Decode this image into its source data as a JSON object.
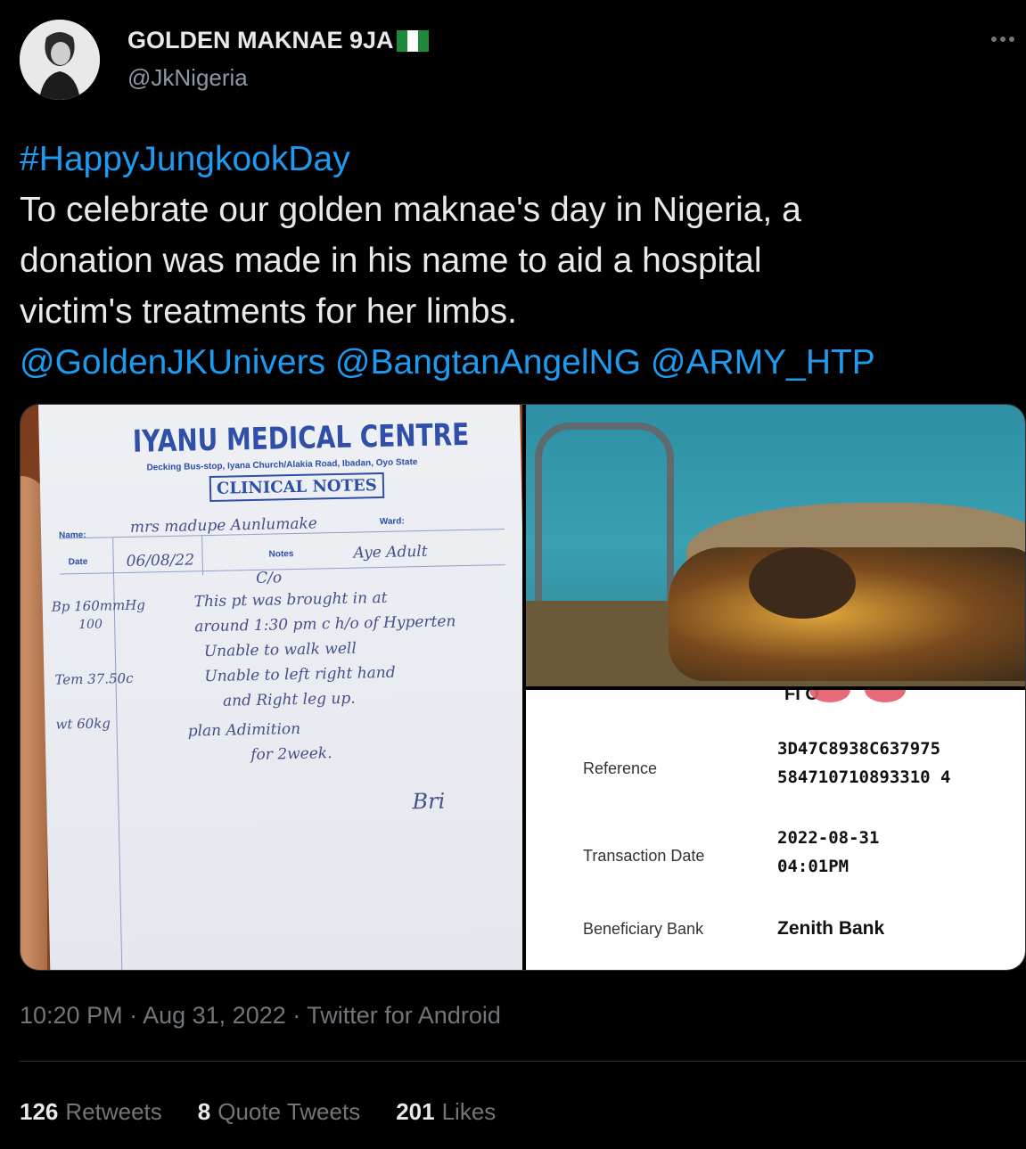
{
  "author": {
    "display_name": "GOLDEN MAKNAE 9JA",
    "handle": "@JkNigeria",
    "flag_icon": "nigeria-flag-icon"
  },
  "tweet": {
    "hashtag": "#HappyJungkookDay",
    "lines": [
      "To celebrate our golden maknae's day in Nigeria, a",
      "donation was made in his name to aid a hospital",
      "victim's treatments for her limbs."
    ],
    "mentions": "@GoldenJKUnivers @BangtanAngelNG @ARMY_HTP"
  },
  "media": {
    "clinical_notes": {
      "clinic_name": "IYANU MEDICAL CENTRE",
      "address": "Decking Bus-stop, Iyana Church/Alakia Road, Ibadan, Oyo State",
      "title": "CLINICAL NOTES",
      "name_label": "Name:",
      "ward_label": "Ward:",
      "date_label": "Date",
      "notes_label": "Notes",
      "handwriting": {
        "name": "mrs madupe Aunlumake",
        "date": "06/08/22",
        "adult": "Aye Adult",
        "co": "C/o",
        "bp": "Bp 160mmHg",
        "bp_den": "100",
        "temp": "Tem 37.50c",
        "wt": "wt 60kg",
        "l1": "This pt was brought in at",
        "l2": "around 1:30 pm c h/o of Hyperten",
        "l3": "Unable to walk well",
        "l4": "Unable to left right hand",
        "l5": "and Right leg up.",
        "l6": "plan  Adimition",
        "l7": "for 2week.",
        "sig": "Bri"
      }
    },
    "receipt": {
      "top_fragment": "FI    O",
      "rows": [
        {
          "label": "Reference",
          "value_lines": [
            "3D47C8938C637975",
            "584710710893310 4"
          ]
        },
        {
          "label": "Transaction Date",
          "value_lines": [
            "2022-08-31",
            "04:01PM"
          ]
        }
      ],
      "bank_label": "Beneficiary Bank",
      "bank_value": "Zenith Bank"
    }
  },
  "meta": {
    "time": "10:20 PM",
    "separator": " · ",
    "date": "Aug 31, 2022",
    "source": "Twitter for Android"
  },
  "stats": {
    "retweets_count": "126",
    "retweets_label": "Retweets",
    "quotes_count": "8",
    "quotes_label": "Quote Tweets",
    "likes_count": "201",
    "likes_label": "Likes"
  },
  "colors": {
    "background": "#000000",
    "text": "#e7e9ea",
    "link": "#1d9bf0",
    "muted": "#71767b"
  }
}
